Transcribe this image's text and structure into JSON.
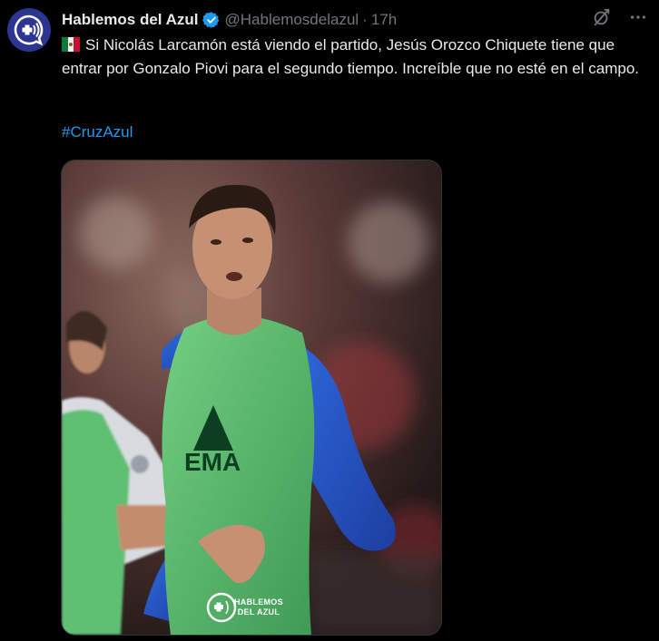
{
  "author": {
    "name": "Hablemos del Azul",
    "handle": "@Hablemosdelazul",
    "time": "17h"
  },
  "tweet": {
    "text": "Si Nicolás Larcamón está viendo el partido, Jesús Orozco Chiquete tiene que entrar por Gonzalo Piovi para el segundo tiempo. Increíble que no esté en el campo.",
    "hashtag": "#CruzAzul"
  },
  "media": {
    "watermark_line1": "HABLEMOS",
    "watermark_line2": "DEL AZUL",
    "bib_lettering": "EMA",
    "sponsor_patch": "boxrocket"
  },
  "icons": {
    "verified": "verified-badge-icon",
    "grok": "grok-icon",
    "more": "more-icon"
  },
  "colors": {
    "background": "#000000",
    "text": "#e7e9ea",
    "muted": "#71767b",
    "link": "#1d9bf0",
    "brand": "#2c3592"
  }
}
